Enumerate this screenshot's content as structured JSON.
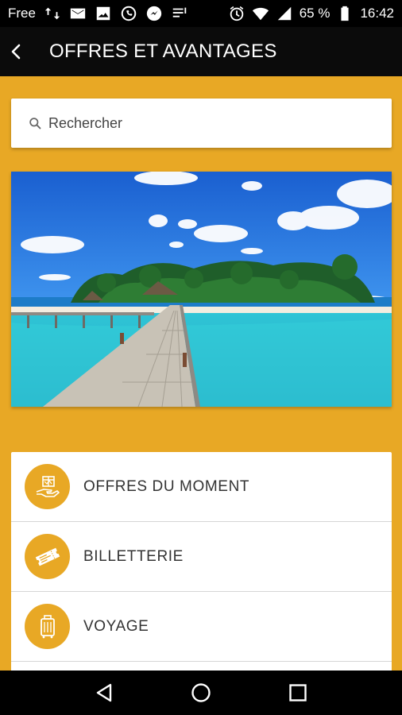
{
  "status_bar": {
    "carrier": "Free",
    "battery": "65 %",
    "time": "16:42",
    "icons": [
      "data-transfer-icon",
      "mail-icon",
      "image-icon",
      "whatsapp-icon",
      "messenger-icon",
      "notes-icon",
      "alarm-icon",
      "wifi-icon",
      "signal-icon",
      "battery-icon"
    ]
  },
  "header": {
    "title": "OFFRES ET AVANTAGES",
    "back_icon": "back-arrow-icon"
  },
  "search": {
    "placeholder": "Rechercher",
    "icon": "search-icon"
  },
  "hero": {
    "image": "tropical-island-pier-image"
  },
  "menu": {
    "items": [
      {
        "label": "OFFRES DU MOMENT",
        "icon": "gift-hand-icon"
      },
      {
        "label": "BILLETTERIE",
        "icon": "ticket-icon"
      },
      {
        "label": "VOYAGE",
        "icon": "suitcase-icon"
      }
    ]
  },
  "nav_bar": {
    "back": "nav-back-icon",
    "home": "nav-home-icon",
    "recents": "nav-recents-icon"
  },
  "colors": {
    "accent": "#E8A825",
    "app_bar": "#0b0b0b",
    "status_bar": "#000000",
    "card": "#FFFFFF",
    "text": "#333333"
  }
}
